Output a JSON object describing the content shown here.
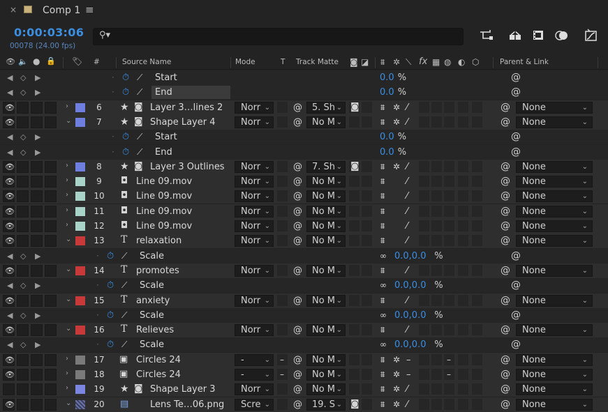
{
  "tab": {
    "close": "×",
    "title": "Comp 1",
    "menu": "≡"
  },
  "time": {
    "timecode": "0:00:03:06",
    "frames": "00078 (24.00 fps)"
  },
  "search": {
    "icon": "search-icon",
    "value": ""
  },
  "toolbar_icons": [
    "flowchart-icon",
    "draft-3d-icon",
    "frame-blending-icon",
    "motion-blur-icon",
    "graph-editor-icon"
  ],
  "header": {
    "source_name": "Source Name",
    "number": "#",
    "mode": "Mode",
    "t": "T",
    "track_matte": "Track Matte",
    "parent_link": "Parent & Link",
    "switches": "fx"
  },
  "label_colors": {
    "blue": "#6f7fe0",
    "aqua": "#a9d2c8",
    "red": "#c83a3a",
    "gray": "#7a7a7a",
    "lavender": "#7a86e0"
  },
  "rows": [
    {
      "kind": "prop",
      "indent": 1,
      "name": "Start",
      "value": "0.0",
      "unit": "%"
    },
    {
      "kind": "prop",
      "indent": 1,
      "name": "End",
      "value": "0.0",
      "unit": "%",
      "selected": true
    },
    {
      "kind": "layer",
      "num": "6",
      "label": "blue",
      "icon": "star",
      "icon2": "shape-icon",
      "name": "Layer 3…lines 2",
      "mode": "Norr",
      "tm": "5. Sh",
      "parent": "None",
      "twirl": "›",
      "matte": true
    },
    {
      "kind": "layer",
      "num": "7",
      "label": "blue",
      "icon": "star",
      "icon2": "precomp-icon",
      "name": "Shape Layer 4",
      "mode": "Norr",
      "tm": "No M",
      "parent": "None",
      "twirl": "⌄"
    },
    {
      "kind": "prop",
      "indent": 1,
      "name": "Start",
      "value": "0.0",
      "unit": "%"
    },
    {
      "kind": "prop",
      "indent": 1,
      "name": "End",
      "value": "0.0",
      "unit": "%"
    },
    {
      "kind": "layer",
      "num": "8",
      "label": "blue",
      "icon": "star",
      "icon2": "shape-icon",
      "name": "Layer 3 Outlines",
      "mode": "Norr",
      "tm": "7. Sh",
      "parent": "None",
      "twirl": "›",
      "matte": true
    },
    {
      "kind": "layer",
      "num": "9",
      "label": "aqua",
      "icon": "file",
      "name": "Line 09.mov",
      "mode": "Norr",
      "tm": "No M",
      "parent": "None",
      "twirl": "›"
    },
    {
      "kind": "layer",
      "num": "10",
      "label": "aqua",
      "icon": "file",
      "name": "Line 09.mov",
      "mode": "Norr",
      "tm": "No M",
      "parent": "None",
      "twirl": "›"
    },
    {
      "kind": "layer",
      "num": "11",
      "label": "aqua",
      "icon": "file",
      "name": "Line 09.mov",
      "mode": "Norr",
      "tm": "No M",
      "parent": "None",
      "twirl": "›"
    },
    {
      "kind": "layer",
      "num": "12",
      "label": "aqua",
      "icon": "file",
      "name": "Line 09.mov",
      "mode": "Norr",
      "tm": "No M",
      "parent": "None",
      "twirl": "›"
    },
    {
      "kind": "layer",
      "num": "13",
      "label": "red",
      "icon": "text",
      "name": " relaxation",
      "mode": "Norr",
      "tm": "No M",
      "parent": "None",
      "twirl": "⌄"
    },
    {
      "kind": "prop",
      "indent": 0,
      "name": "Scale",
      "value": "0.0,0.0",
      "unit": "%",
      "link": true
    },
    {
      "kind": "layer",
      "num": "14",
      "label": "red",
      "icon": "text",
      "name": "promotes",
      "mode": "Norr",
      "tm": "No M",
      "parent": "None",
      "twirl": "⌄"
    },
    {
      "kind": "prop",
      "indent": 0,
      "name": "Scale",
      "value": "0.0,0.0",
      "unit": "%",
      "link": true
    },
    {
      "kind": "layer",
      "num": "15",
      "label": "red",
      "icon": "text",
      "name": "anxiety",
      "mode": "Norr",
      "tm": "No M",
      "parent": "None",
      "twirl": "⌄"
    },
    {
      "kind": "prop",
      "indent": 0,
      "name": "Scale",
      "value": "0.0,0.0",
      "unit": "%",
      "link": true
    },
    {
      "kind": "layer",
      "num": "16",
      "label": "red",
      "icon": "text",
      "name": "Relieves",
      "mode": "Norr",
      "tm": "No M",
      "parent": "None",
      "twirl": "⌄"
    },
    {
      "kind": "prop",
      "indent": 0,
      "name": "Scale",
      "value": "0.0,0.0",
      "unit": "%",
      "link": true
    },
    {
      "kind": "layer",
      "num": "17",
      "label": "gray",
      "icon": "image",
      "name": "Circles 24",
      "mode": "-",
      "tm": "No M",
      "parent": "None",
      "twirl": "›",
      "dash": true
    },
    {
      "kind": "layer",
      "num": "18",
      "label": "gray",
      "icon": "image",
      "name": "Circles 24",
      "mode": "-",
      "tm": "No M",
      "parent": "None",
      "twirl": "›",
      "dash": true
    },
    {
      "kind": "layer",
      "num": "19",
      "label": "lavender",
      "icon": "star",
      "icon2": "precomp-icon",
      "name": "Shape Layer 3",
      "mode": "Norr",
      "tm": "No M",
      "parent": "None",
      "twirl": "›",
      "hidden_eye": true
    },
    {
      "kind": "layer",
      "num": "20",
      "label": "pattern",
      "icon": "png",
      "name": "Lens Te…06.png",
      "mode": "Scre",
      "tm": "19. S",
      "parent": "None",
      "twirl": "⌄",
      "matte": true
    }
  ]
}
